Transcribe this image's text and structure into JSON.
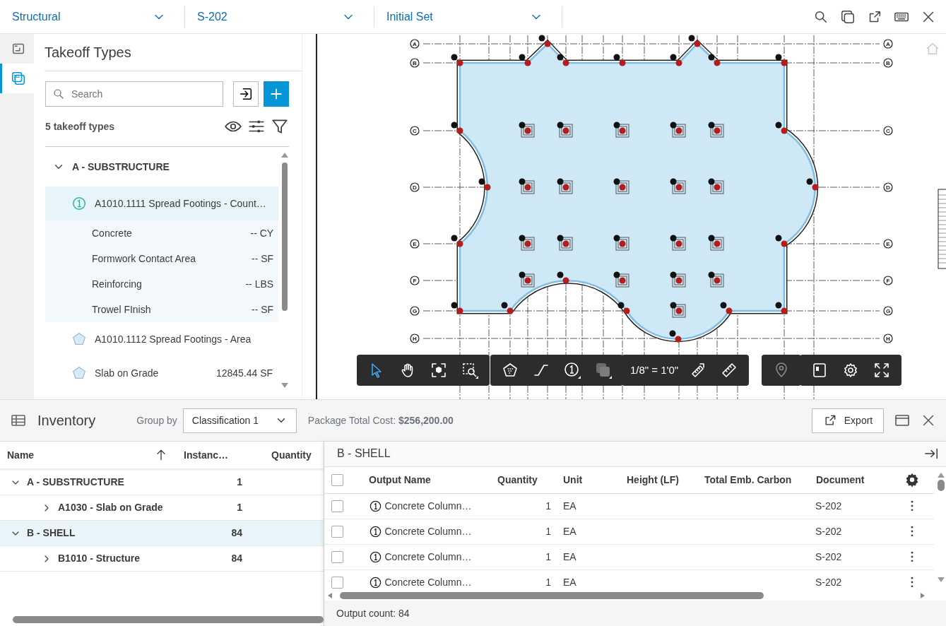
{
  "top_bar": {
    "dropdowns": [
      {
        "label": "Structural"
      },
      {
        "label": "S-202"
      },
      {
        "label": "Initial Set"
      }
    ]
  },
  "side_rail": {
    "tabs": [
      {
        "kind": "sheets",
        "selected": false
      },
      {
        "kind": "takeoff",
        "selected": true
      }
    ]
  },
  "takeoff_panel": {
    "title": "Takeoff Types",
    "search": {
      "placeholder": "Search"
    },
    "count": "5 takeoff types",
    "groups": [
      {
        "label": "A - SUBSTRUCTURE",
        "expanded": true,
        "items": [
          {
            "kind": "count",
            "label": "A1010.1111 Spread Footings - Count…",
            "selected": true,
            "children": [
              {
                "label": "Concrete",
                "value": "-- CY"
              },
              {
                "label": "Formwork Contact Area",
                "value": "-- SF"
              },
              {
                "label": "Reinforcing",
                "value": "-- LBS"
              },
              {
                "label": "Trowel FInish",
                "value": "-- SF"
              }
            ]
          },
          {
            "kind": "area",
            "label": "A1010.1112 Spread Footings - Area",
            "selected": false
          },
          {
            "kind": "area",
            "label": "Slab on Grade",
            "value": "12845.44 SF",
            "selected": false
          }
        ]
      }
    ]
  },
  "drawing": {
    "grid_labels_left": [
      "A",
      "B",
      "C",
      "D",
      "E",
      "F",
      "G",
      "H"
    ],
    "grid_labels_right": [
      "A",
      "B",
      "C",
      "D",
      "E",
      "F",
      "G",
      "H"
    ],
    "scale": "1/8\" = 1'0\""
  },
  "inventory": {
    "title": "Inventory",
    "group_by_label": "Group by",
    "group_by": "Classification 1",
    "total": "Package Total Cost: **$256,200.00**",
    "export": "Export",
    "columns": [
      {
        "label": "Name",
        "sorted": true
      },
      {
        "label": "Instanc…",
        "sorted": false
      },
      {
        "label": "Quantity",
        "sorted": false
      }
    ],
    "rows": [
      {
        "name": "A - SUBSTRUCTURE",
        "instances": "1",
        "expanded": true,
        "selected": false,
        "children": [
          {
            "name": "A1030 - Slab on Grade",
            "instances": "1",
            "expanded": false,
            "selected": false
          }
        ]
      },
      {
        "name": "B - SHELL",
        "instances": "84",
        "expanded": true,
        "selected": true,
        "children": [
          {
            "name": "B1010 - Structure",
            "instances": "84",
            "expanded": false,
            "selected": false
          }
        ]
      }
    ]
  },
  "detail": {
    "title": "B - SHELL",
    "select_all_checked": false,
    "columns": [
      "Output Name",
      "Quantity",
      "Unit",
      "Height (LF)",
      "Total Emb. Carbon",
      "Document"
    ],
    "rows": [
      {
        "checked": false,
        "name": "Concrete Column…",
        "quantity": "1",
        "unit": "EA",
        "document": "S-202"
      },
      {
        "checked": false,
        "name": "Concrete Column…",
        "quantity": "1",
        "unit": "EA",
        "document": "S-202"
      },
      {
        "checked": false,
        "name": "Concrete Column…",
        "quantity": "1",
        "unit": "EA",
        "document": "S-202"
      },
      {
        "checked": false,
        "name": "Concrete Column…",
        "quantity": "1",
        "unit": "EA",
        "document": "S-202"
      }
    ],
    "footer": "Output count: 84"
  }
}
